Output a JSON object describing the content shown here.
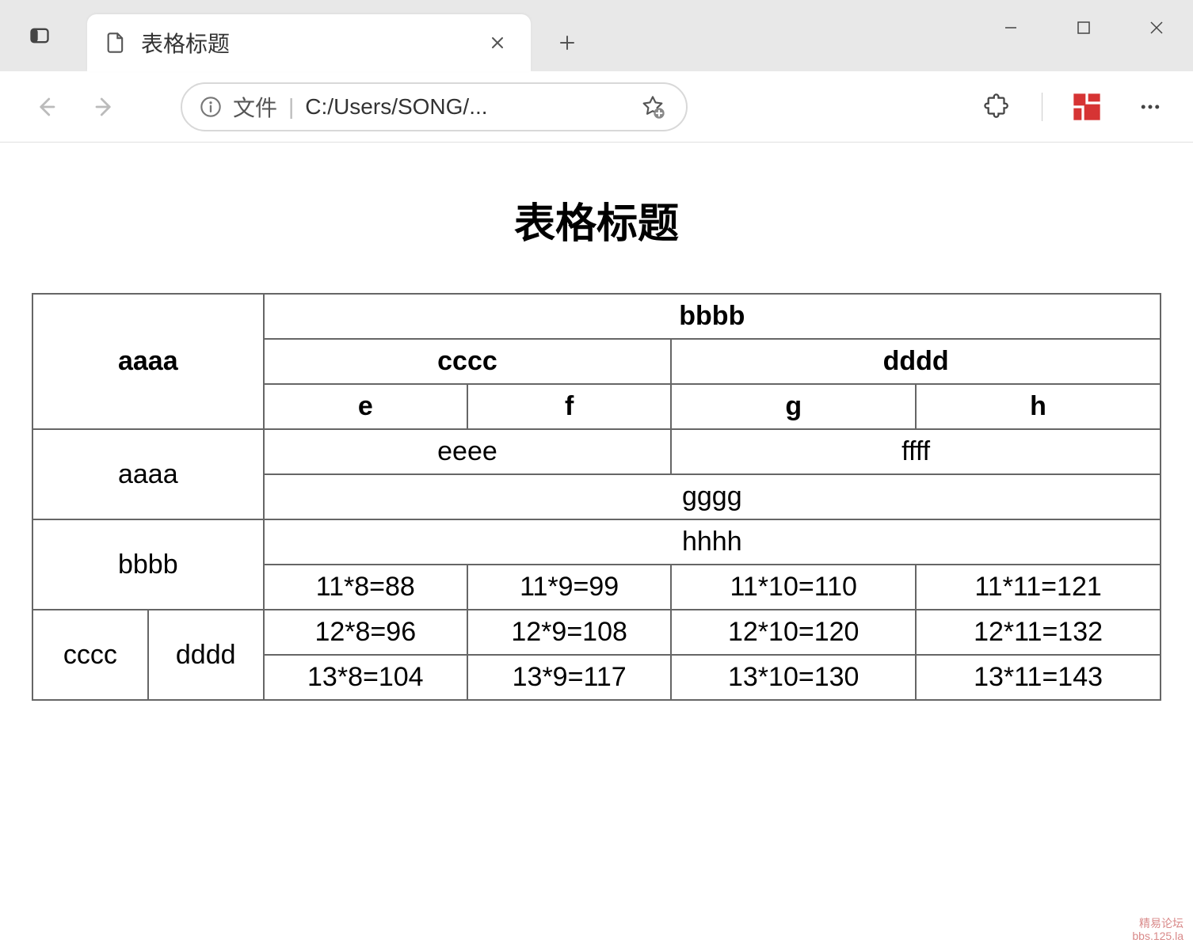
{
  "browser": {
    "tab_title": "表格标题",
    "address": {
      "file_label": "文件",
      "url": "C:/Users/SONG/..."
    }
  },
  "page": {
    "title": "表格标题"
  },
  "table": {
    "thead": {
      "r1": {
        "aaaa": "aaaa",
        "bbbb": "bbbb"
      },
      "r2": {
        "cccc": "cccc",
        "dddd": "dddd"
      },
      "r3": {
        "e": "e",
        "f": "f",
        "g": "g",
        "h": "h"
      }
    },
    "tbody": {
      "r4": {
        "aaaa": "aaaa",
        "eeee": "eeee",
        "ffff": "ffff"
      },
      "r5": {
        "gggg": "gggg"
      },
      "r6": {
        "bbbb": "bbbb",
        "hhhh": "hhhh"
      },
      "r7": {
        "c1": "11*8=88",
        "c2": "11*9=99",
        "c3": "11*10=110",
        "c4": "11*11=121"
      },
      "r8": {
        "cccc": "cccc",
        "dddd": "dddd",
        "c1": "12*8=96",
        "c2": "12*9=108",
        "c3": "12*10=120",
        "c4": "12*11=132"
      },
      "r9": {
        "c1": "13*8=104",
        "c2": "13*9=117",
        "c3": "13*10=130",
        "c4": "13*11=143"
      }
    }
  },
  "watermark": {
    "line1": "精易论坛",
    "line2": "bbs.125.la"
  }
}
